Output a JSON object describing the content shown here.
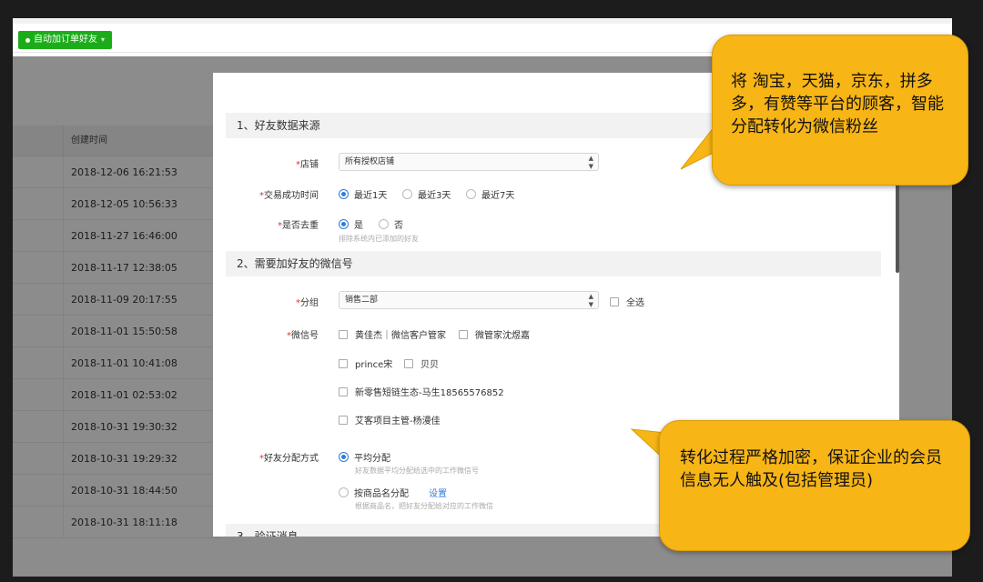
{
  "app": {
    "active_tab": "自动加订单好友",
    "table": {
      "header_time": "创建时间",
      "rows": [
        "2018-12-06 16:21:53",
        "2018-12-05 10:56:33",
        "2018-11-27 16:46:00",
        "2018-11-17 12:38:05",
        "2018-11-09 20:17:55",
        "2018-11-01 15:50:58",
        "2018-11-01 10:41:08",
        "2018-11-01 02:53:02",
        "2018-10-31 19:30:32",
        "2018-10-31 19:29:32",
        "2018-10-31 18:44:50",
        "2018-10-31 18:11:18"
      ]
    }
  },
  "modal": {
    "section1": "1、好友数据来源",
    "store": {
      "label": "店铺",
      "value": "所有授权店铺"
    },
    "trade_time": {
      "label": "交易成功时间",
      "options": [
        "最近1天",
        "最近3天",
        "最近7天"
      ],
      "selected": 0
    },
    "dedupe": {
      "label": "是否去重",
      "options": [
        "是",
        "否"
      ],
      "selected": 0,
      "hint": "排除系统内已添加的好友"
    },
    "section2": "2、需要加好友的微信号",
    "group": {
      "label": "分组",
      "value": "销售二部",
      "select_all": "全选"
    },
    "wechat": {
      "label": "微信号",
      "accounts": [
        "黄佳杰｜微信客户管家",
        "微管家沈煜嘉",
        "prince宋",
        "贝贝",
        "新零售短链生态-马生18565576852",
        "艾客项目主管-杨漫佳"
      ]
    },
    "distribution": {
      "label": "好友分配方式",
      "option1": "平均分配",
      "option1_hint": "好友数据平均分配给选中的工作微信号",
      "option2": "按商品名分配",
      "option2_link": "设置",
      "option2_hint": "根据商品名，把好友分配给对应的工作微信"
    },
    "section3": "3、验证消息"
  },
  "callouts": {
    "top": "将 淘宝，天猫，京东，拼多多，有赞等平台的顾客，智能分配转化为微信粉丝",
    "bottom": "转化过程严格加密，保证企业的会员信息无人触及(包括管理员)"
  },
  "colors": {
    "accent_green": "#1aad19",
    "radio_blue": "#2f7ddc",
    "callout_yellow": "#f7b516",
    "required_red": "#e0312e"
  }
}
